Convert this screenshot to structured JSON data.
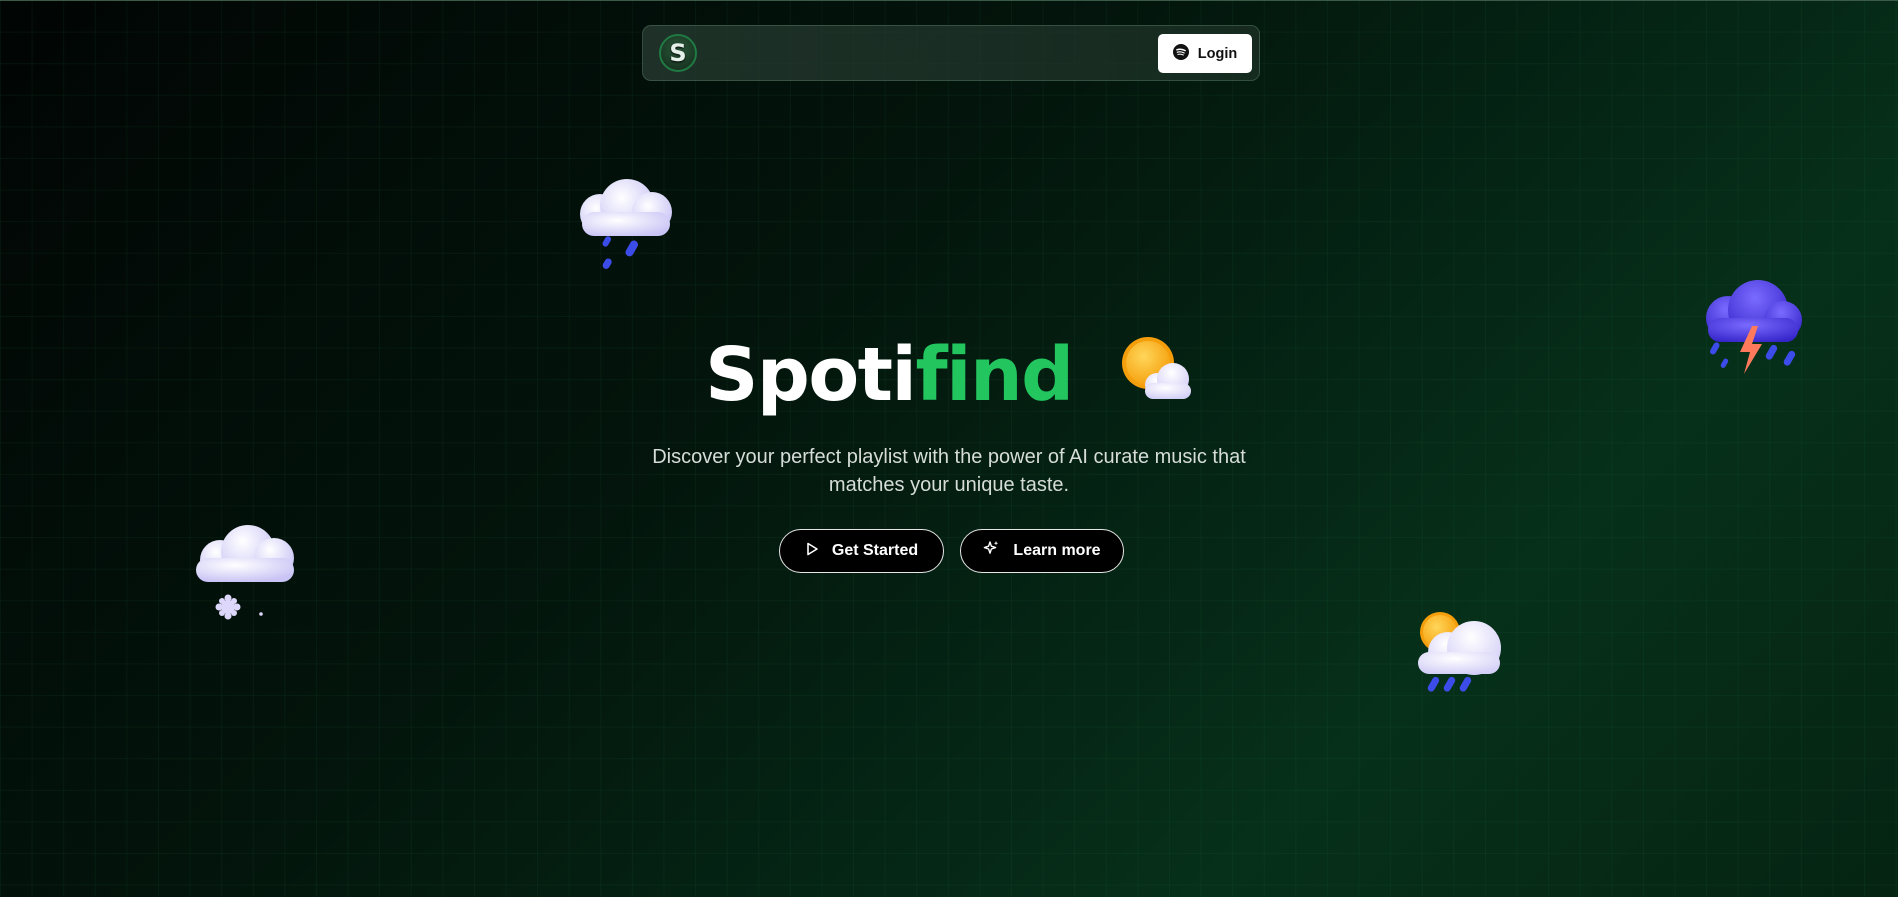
{
  "nav": {
    "logo_letter": "S",
    "login_label": "Login"
  },
  "hero": {
    "title_part1": "Spoti",
    "title_part2": "find",
    "subtitle_line1": "Discover your perfect playlist with the power of AI curate music that",
    "subtitle_line2": "matches your unique taste."
  },
  "buttons": {
    "get_started": "Get Started",
    "learn_more": "Learn more"
  },
  "decorations": [
    "rain-cloud-icon",
    "sun-behind-cloud-icon",
    "thunderstorm-cloud-icon",
    "snow-cloud-icon",
    "sun-rain-cloud-icon"
  ],
  "colors": {
    "accent": "#22c55e",
    "background": "#03150c"
  }
}
